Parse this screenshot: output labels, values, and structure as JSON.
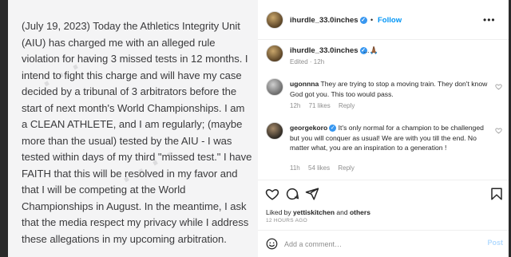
{
  "post_image": {
    "text": "(July 19, 2023) Today the Athletics Integrity Unit (AIU) has charged me with an alleged rule violation for having 3 missed tests in 12 months. I intend to fight this charge and will have my case decided by a tribunal of 3 arbitrators before the start of next month's World Championships. I am a CLEAN ATHLETE, and I am regularly; (maybe more than the usual) tested by the AIU - I was tested within days of my third \"missed test.\" I have FAITH that this will be resolved in my favor and that I will be competing at the World Championships in August. In the meantime, I ask that the media respect my privacy while I address these allegations in my upcoming arbitration."
  },
  "header": {
    "username": "ihurdle_33.0inches",
    "verified_glyph": "✓",
    "separator": "•",
    "follow_label": "Follow",
    "more_glyph": "•••"
  },
  "caption": {
    "username": "ihurdle_33.0inches",
    "verified_glyph": "✓",
    "text": "...🙏🏾",
    "edited": "Edited · 12h"
  },
  "comments": [
    {
      "username": "ugonnna",
      "text": "They are trying to stop a moving train. They don't know God got you. This too would pass.",
      "time": "12h",
      "likes": "71 likes",
      "reply": "Reply"
    },
    {
      "username": "georgekoro",
      "verified_glyph": "✓",
      "text": "It's only normal for a champion to be challenged but you will conquer as usual! We are with you till the end. No matter what, you are an inspiration to a generation !",
      "time": "11h",
      "likes": "54 likes",
      "reply": "Reply"
    }
  ],
  "actions": {
    "liked_prefix": "Liked by",
    "liked_user": "yettiskitchen",
    "liked_and": "and",
    "liked_others": "others",
    "time_ago": "12 HOURS AGO"
  },
  "add_comment": {
    "placeholder": "Add a comment…",
    "post_label": "Post"
  },
  "colors": {
    "accent": "#0095f6",
    "verified": "#3897f0",
    "muted": "#8e8e8e",
    "text": "#262626"
  },
  "icons": [
    "heart-icon",
    "comment-icon",
    "share-icon",
    "bookmark-icon",
    "emoji-icon",
    "verified-icon",
    "more-icon"
  ]
}
